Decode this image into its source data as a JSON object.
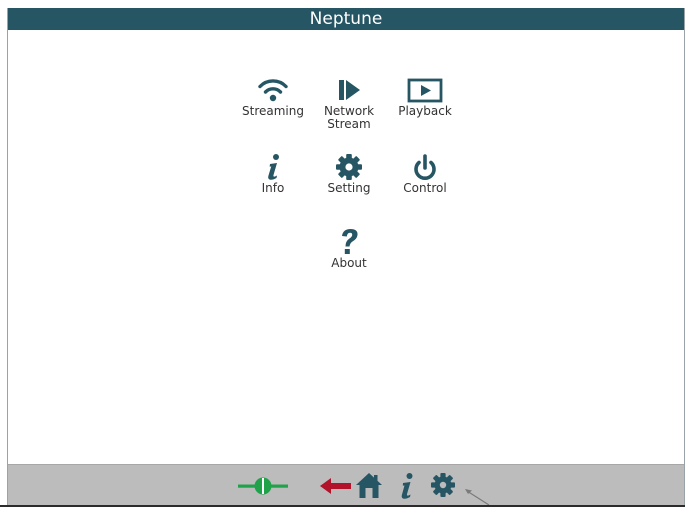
{
  "window": {
    "title": "Neptune"
  },
  "menu": {
    "items": [
      {
        "id": "streaming",
        "label": "Streaming",
        "icon": "wifi-icon"
      },
      {
        "id": "network-stream",
        "label": "Network\nStream",
        "icon": "play-bar-icon"
      },
      {
        "id": "playback",
        "label": "Playback",
        "icon": "play-box-icon"
      },
      {
        "id": "info",
        "label": "Info",
        "icon": "info-icon"
      },
      {
        "id": "setting",
        "label": "Setting",
        "icon": "gear-icon"
      },
      {
        "id": "control",
        "label": "Control",
        "icon": "power-icon"
      },
      {
        "id": "about",
        "label": "About",
        "icon": "question-icon"
      }
    ]
  },
  "footer": {
    "buttons": [
      {
        "id": "connection",
        "icon": "connection-plug-icon",
        "color": "#1fa24a"
      },
      {
        "id": "back",
        "icon": "back-arrow-icon",
        "color": "#b3122b"
      },
      {
        "id": "home",
        "icon": "home-icon",
        "color": "#265564"
      },
      {
        "id": "info",
        "icon": "info-icon",
        "color": "#265564"
      },
      {
        "id": "settings",
        "icon": "gear-icon",
        "color": "#265564"
      }
    ]
  },
  "colors": {
    "accent": "#265564",
    "footer_bg": "#bcbcbc",
    "connected_green": "#1fa24a",
    "back_red": "#b3122b"
  }
}
